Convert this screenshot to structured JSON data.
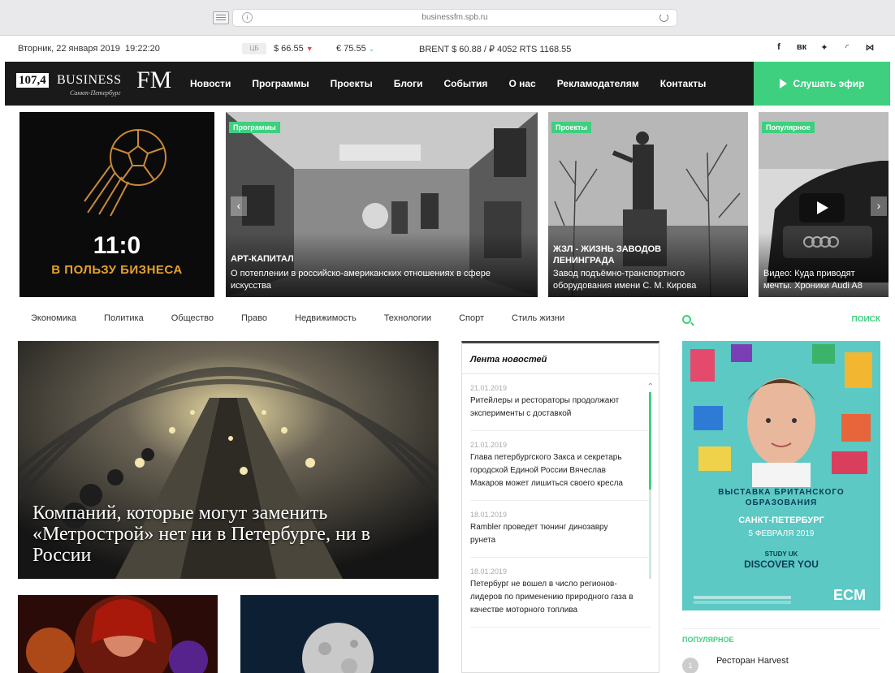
{
  "browser": {
    "url": "businessfm.spb.ru"
  },
  "ticker": {
    "date": "Вторник, 22 января 2019",
    "time": "19:22:20",
    "cb_label": "ЦБ",
    "usd": "$ 66.55",
    "eur": "€ 75.55",
    "brent_rts": "BRENT $ 60.88 / ₽ 4052  RTS 1168.55"
  },
  "social": [
    "f",
    "vk",
    "tw",
    "rss",
    "ya"
  ],
  "logo": {
    "freq": "107,4",
    "name": "BUSINESS",
    "fm": "FM",
    "city": "Санкт-Петербург"
  },
  "nav": {
    "items": [
      "Новости",
      "Программы",
      "Проекты",
      "Блоги",
      "События",
      "О нас",
      "Рекламодателям",
      "Контакты"
    ],
    "listen": "Слушать эфир"
  },
  "slider": {
    "promo": {
      "score": "11:0",
      "subtitle": "В ПОЛЬЗУ БИЗНЕСА"
    },
    "cards": [
      {
        "tag": "Программы",
        "rubric": "АРТ-КАПИТАЛ",
        "caption": "О потеплении в российско-американских отношениях в сфере искусства"
      },
      {
        "tag": "Проекты",
        "rubric": "ЖЗЛ - ЖИЗНЬ ЗАВОДОВ ЛЕНИНГРАДА",
        "caption": "Завод подъёмно-транспортного оборудования имени С. М. Кирова"
      },
      {
        "tag": "Популярное",
        "rubric": "",
        "caption": "Видео: Куда приводят мечты. Хроники Audi A8"
      }
    ]
  },
  "categories": [
    "Экономика",
    "Политика",
    "Общество",
    "Право",
    "Недвижимость",
    "Технологии",
    "Спорт",
    "Стиль жизни"
  ],
  "search": {
    "label": "ПОИСК"
  },
  "feature": {
    "title": "Компаний, которые могут заменить «Метрострой» нет ни в Петербурге, ни в России"
  },
  "feed": {
    "title": "Лента новостей",
    "items": [
      {
        "date": "21.01.2019",
        "text": "Ритейлеры и рестораторы продолжают эксперименты с доставкой"
      },
      {
        "date": "21.01.2019",
        "text": "Глава петербургского Заксa и секретарь городской Единой России Вячеслав Макаров может лишиться своего кресла"
      },
      {
        "date": "18.01.2019",
        "text": "Rambler проведет тюнинг динозавру рунета"
      },
      {
        "date": "18.01.2019",
        "text": "Петербург не вошел в число регионов-лидеров по применению природного газа в качестве моторного топлива"
      }
    ]
  },
  "ad": {
    "line1": "ВЫСТАВКА БРИТАНСКОГО ОБРАЗОВАНИЯ",
    "city": "САНКТ-ПЕТЕРБУРГ",
    "date": "5 ФЕВРАЛЯ 2019",
    "study": "STUDY UK",
    "discover": "DISCOVER YOU",
    "brand": "ECM"
  },
  "popular": {
    "title": "популярное",
    "items": [
      {
        "num": "1",
        "text": "Ресторан Harvest"
      }
    ]
  },
  "colors": {
    "accent": "#3ecf7f",
    "nav_bg": "#1a1a1a",
    "promo_orange": "#e7a12c",
    "rate_down": "#e24a4a"
  }
}
